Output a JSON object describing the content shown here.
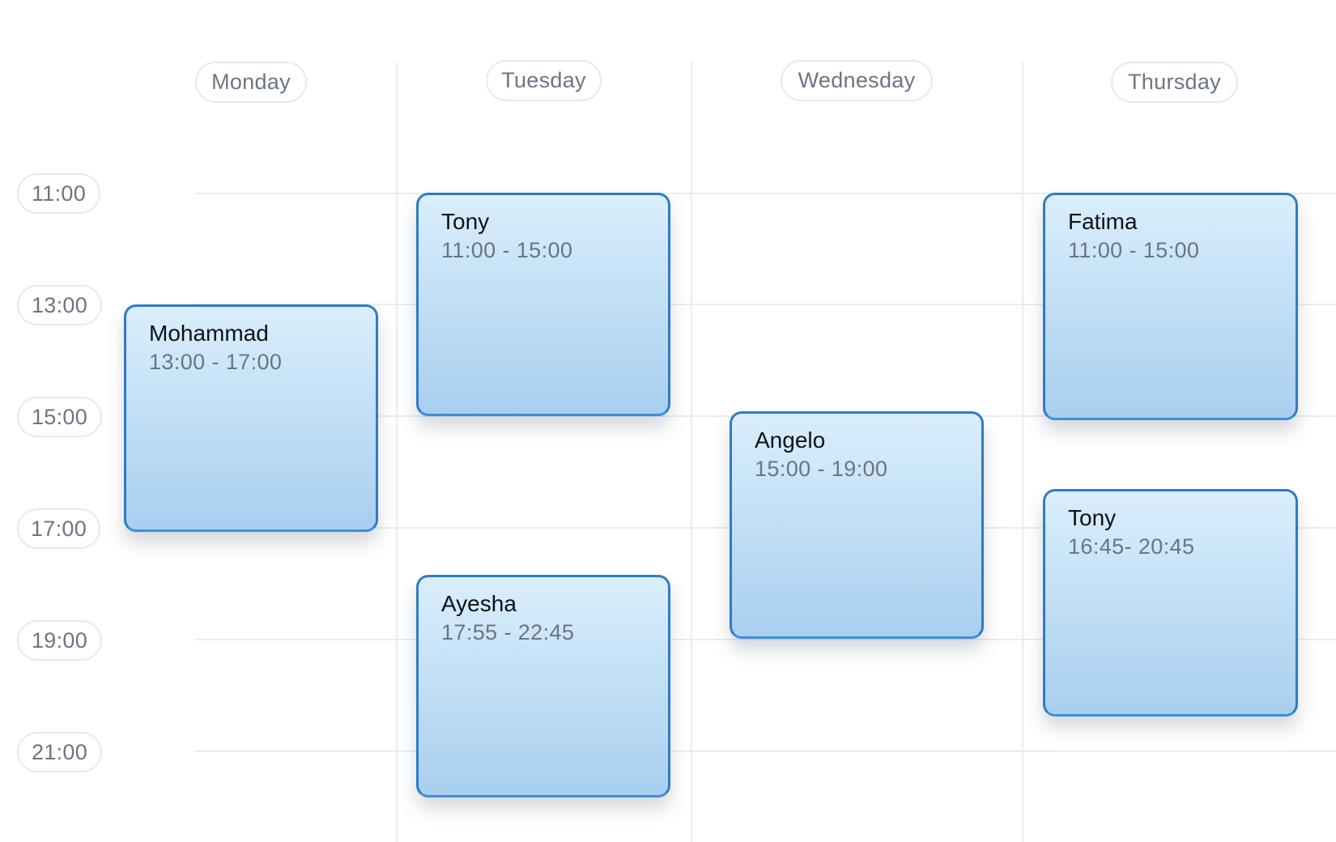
{
  "calendar": {
    "days": [
      {
        "label": "Monday"
      },
      {
        "label": "Tuesday"
      },
      {
        "label": "Wednesday"
      },
      {
        "label": "Thursday"
      }
    ],
    "time_slots": [
      "11:00",
      "13:00",
      "15:00",
      "17:00",
      "19:00",
      "21:00"
    ],
    "events": [
      {
        "day": "Monday",
        "name": "Mohammad",
        "time": "13:00 - 17:00"
      },
      {
        "day": "Tuesday",
        "name": "Tony",
        "time": "11:00 - 15:00"
      },
      {
        "day": "Tuesday",
        "name": "Ayesha",
        "time": "17:55 - 22:45"
      },
      {
        "day": "Wednesday",
        "name": "Angelo",
        "time": "15:00 - 19:00"
      },
      {
        "day": "Thursday",
        "name": "Fatima",
        "time": "11:00 - 15:00"
      },
      {
        "day": "Thursday",
        "name": "Tony",
        "time": "16:45- 20:45"
      }
    ]
  },
  "colors": {
    "event_border": "#2f7cc3",
    "event_fill_top": "#daeefc",
    "event_fill_bottom": "#a9cfef",
    "pill_text": "#6b7683",
    "gridline": "#ececee"
  }
}
